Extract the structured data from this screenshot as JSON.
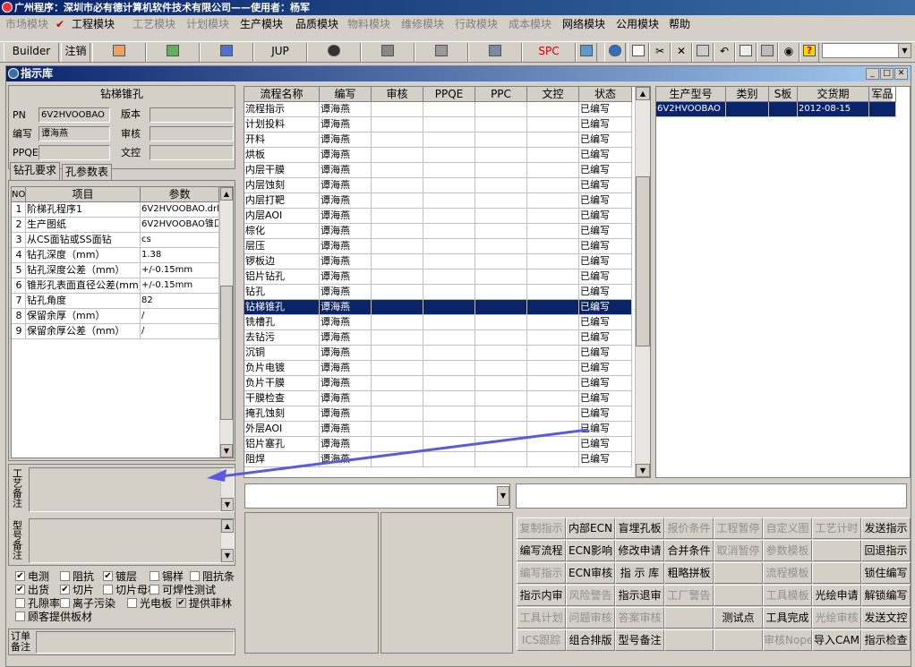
{
  "app_title": "广州程序：深圳市必有德计算机软件技术有限公司——使用者：杨军",
  "menu": [
    {
      "label": "市场模块",
      "enabled": false
    },
    {
      "label": "工程模块",
      "enabled": true
    },
    {
      "label": "工艺模块",
      "enabled": false
    },
    {
      "label": "计划模块",
      "enabled": false
    },
    {
      "label": "生产模块",
      "enabled": true
    },
    {
      "label": "品质模块",
      "enabled": true
    },
    {
      "label": "物料模块",
      "enabled": false
    },
    {
      "label": "维修模块",
      "enabled": false
    },
    {
      "label": "行政模块",
      "enabled": false
    },
    {
      "label": "成本模块",
      "enabled": false
    },
    {
      "label": "网络模块",
      "enabled": true
    },
    {
      "label": "公用模块",
      "enabled": true
    },
    {
      "label": "帮助",
      "enabled": true
    }
  ],
  "toolbar": {
    "builder": "Builder",
    "logout": "注销",
    "jup": "JUP",
    "spc": "SPC"
  },
  "window_title": "指示库",
  "left": {
    "heading": "钻梯锥孔",
    "fields": {
      "pn_label": "PN",
      "pn_value": "6V2HVOOBAO",
      "version_label": "版本",
      "version_value": "",
      "author_label": "编写",
      "author_value": "谭海燕",
      "review_label": "审核",
      "review_value": "",
      "ppqe_label": "PPQE",
      "ppqe_value": "",
      "doc_label": "文控",
      "doc_value": ""
    },
    "tabs": [
      "钻孔要求",
      "孔参数表"
    ],
    "param_grid": {
      "headers": [
        "NO",
        "项目",
        "参数"
      ],
      "rows": [
        [
          "1",
          "阶梯孔程序1",
          "6V2HVOOBAO.drl"
        ],
        [
          "2",
          "生产图纸",
          "6V2HVOOBAO锥口"
        ],
        [
          "3",
          "从CS面钻或SS面钻",
          "cs"
        ],
        [
          "4",
          "钻孔深度（mm）",
          "1.38"
        ],
        [
          "5",
          "钻孔深度公差（mm）",
          "+/-0.15mm"
        ],
        [
          "6",
          "锥形孔表面直径公差(mm)",
          "+/-0.15mm"
        ],
        [
          "7",
          "钻孔角度",
          "82"
        ],
        [
          "8",
          "保留余厚（mm）",
          "/"
        ],
        [
          "9",
          "保留余厚公差（mm）",
          "/"
        ]
      ]
    },
    "memo1_label": "工艺备注",
    "memo2_label": "型号备注",
    "checks": [
      {
        "label": "电测",
        "checked": true
      },
      {
        "label": "阻抗",
        "checked": false
      },
      {
        "label": "镀层",
        "checked": true
      },
      {
        "label": "锡样",
        "checked": false
      },
      {
        "label": "阻抗条",
        "checked": false
      },
      {
        "label": "出货",
        "checked": true
      },
      {
        "label": "切片",
        "checked": true
      },
      {
        "label": "切片母板",
        "checked": false
      },
      {
        "label": "可焊性测试",
        "checked": false
      },
      {
        "label": "孔隙率",
        "checked": false
      },
      {
        "label": "离子污染",
        "checked": false
      },
      {
        "label": "光电板",
        "checked": false
      },
      {
        "label": "提供菲林",
        "checked": true
      },
      {
        "label": "顾客提供板材",
        "checked": false
      }
    ],
    "order_label": "订单备注"
  },
  "flow_grid": {
    "headers": [
      "流程名称",
      "编写",
      "审核",
      "PPQE",
      "PPC",
      "文控",
      "状态"
    ],
    "rows": [
      [
        "流程指示",
        "谭海燕",
        "",
        "",
        "",
        "",
        "已编写"
      ],
      [
        "计划投料",
        "谭海燕",
        "",
        "",
        "",
        "",
        "已编写"
      ],
      [
        "开料",
        "谭海燕",
        "",
        "",
        "",
        "",
        "已编写"
      ],
      [
        "烘板",
        "谭海燕",
        "",
        "",
        "",
        "",
        "已编写"
      ],
      [
        "内层干膜",
        "谭海燕",
        "",
        "",
        "",
        "",
        "已编写"
      ],
      [
        "内层蚀刻",
        "谭海燕",
        "",
        "",
        "",
        "",
        "已编写"
      ],
      [
        "内层打靶",
        "谭海燕",
        "",
        "",
        "",
        "",
        "已编写"
      ],
      [
        "内层AOI",
        "谭海燕",
        "",
        "",
        "",
        "",
        "已编写"
      ],
      [
        "棕化",
        "谭海燕",
        "",
        "",
        "",
        "",
        "已编写"
      ],
      [
        "层压",
        "谭海燕",
        "",
        "",
        "",
        "",
        "已编写"
      ],
      [
        "锣板边",
        "谭海燕",
        "",
        "",
        "",
        "",
        "已编写"
      ],
      [
        "铝片钻孔",
        "谭海燕",
        "",
        "",
        "",
        "",
        "已编写"
      ],
      [
        "钻孔",
        "谭海燕",
        "",
        "",
        "",
        "",
        "已编写"
      ],
      [
        "钻梯锥孔",
        "谭海燕",
        "",
        "",
        "",
        "",
        "已编写"
      ],
      [
        "铣槽孔",
        "谭海燕",
        "",
        "",
        "",
        "",
        "已编写"
      ],
      [
        "去钻污",
        "谭海燕",
        "",
        "",
        "",
        "",
        "已编写"
      ],
      [
        "沉铜",
        "谭海燕",
        "",
        "",
        "",
        "",
        "已编写"
      ],
      [
        "负片电镀",
        "谭海燕",
        "",
        "",
        "",
        "",
        "已编写"
      ],
      [
        "负片干膜",
        "谭海燕",
        "",
        "",
        "",
        "",
        "已编写"
      ],
      [
        "干膜检查",
        "谭海燕",
        "",
        "",
        "",
        "",
        "已编写"
      ],
      [
        "掩孔蚀刻",
        "谭海燕",
        "",
        "",
        "",
        "",
        "已编写"
      ],
      [
        "外层AOI",
        "谭海燕",
        "",
        "",
        "",
        "",
        "已编写"
      ],
      [
        "铝片塞孔",
        "谭海燕",
        "",
        "",
        "",
        "",
        "已编写"
      ],
      [
        "阻焊",
        "谭海燕",
        "",
        "",
        "",
        "",
        "已编写"
      ]
    ],
    "selected_index": 13
  },
  "model_grid": {
    "headers": [
      "生产型号",
      "类别",
      "S板",
      "交货期",
      "军品"
    ],
    "rows": [
      [
        "6V2HVOOBAO",
        "",
        "",
        "2012-08-15",
        ""
      ]
    ]
  },
  "buttons": [
    [
      {
        "label": "复制指示",
        "enabled": false
      },
      {
        "label": "内部ECN",
        "enabled": true
      },
      {
        "label": "盲埋孔板",
        "enabled": true
      },
      {
        "label": "报价条件",
        "enabled": false
      },
      {
        "label": "工程暂停",
        "enabled": false
      },
      {
        "label": "自定义图",
        "enabled": false
      },
      {
        "label": "工艺计时",
        "enabled": false
      },
      {
        "label": "发送指示",
        "enabled": true
      }
    ],
    [
      {
        "label": "编写流程",
        "enabled": true
      },
      {
        "label": "ECN影响",
        "enabled": true
      },
      {
        "label": "修改申请",
        "enabled": true
      },
      {
        "label": "合并条件",
        "enabled": true
      },
      {
        "label": "取消暂停",
        "enabled": false
      },
      {
        "label": "参数模板",
        "enabled": false
      },
      {
        "label": "",
        "enabled": false
      },
      {
        "label": "回退指示",
        "enabled": true
      }
    ],
    [
      {
        "label": "编写指示",
        "enabled": false
      },
      {
        "label": "ECN审核",
        "enabled": true
      },
      {
        "label": "指 示 库",
        "enabled": true
      },
      {
        "label": "粗略拼板",
        "enabled": true
      },
      {
        "label": "",
        "enabled": false
      },
      {
        "label": "流程模板",
        "enabled": false
      },
      {
        "label": "",
        "enabled": false
      },
      {
        "label": "锁住编写",
        "enabled": true
      }
    ],
    [
      {
        "label": "指示内审",
        "enabled": true
      },
      {
        "label": "风险警告",
        "enabled": false
      },
      {
        "label": "指示退审",
        "enabled": true
      },
      {
        "label": "工厂警告",
        "enabled": false
      },
      {
        "label": "",
        "enabled": false
      },
      {
        "label": "工具模板",
        "enabled": false
      },
      {
        "label": "光绘申请",
        "enabled": true
      },
      {
        "label": "解锁编写",
        "enabled": true
      }
    ],
    [
      {
        "label": "工具计划",
        "enabled": false
      },
      {
        "label": "问题审核",
        "enabled": false
      },
      {
        "label": "答案审核",
        "enabled": false
      },
      {
        "label": "",
        "enabled": false
      },
      {
        "label": "测试点",
        "enabled": true
      },
      {
        "label": "工具完成",
        "enabled": true
      },
      {
        "label": "光绘审核",
        "enabled": false
      },
      {
        "label": "发送文控",
        "enabled": true
      }
    ],
    [
      {
        "label": "ICS跟踪",
        "enabled": false
      },
      {
        "label": "组合排版",
        "enabled": true
      },
      {
        "label": "型号备注",
        "enabled": true
      },
      {
        "label": "",
        "enabled": false
      },
      {
        "label": "",
        "enabled": false
      },
      {
        "label": "审核Nope",
        "enabled": false
      },
      {
        "label": "导入CAM",
        "enabled": true
      },
      {
        "label": "指示检查",
        "enabled": true
      }
    ]
  ],
  "colors": {
    "title_bar": "#0a246a",
    "selection": "#0a246a",
    "face": "#d4d0c8",
    "arrow": "#5a5ae0"
  }
}
